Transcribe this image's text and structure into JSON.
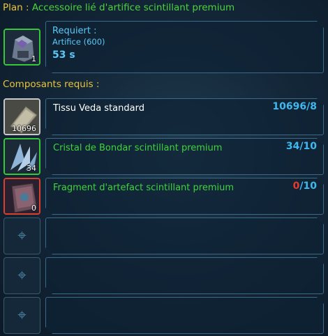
{
  "plan": {
    "label": "Plan :",
    "name": "Accessoire lié d'artifice scintillant premium"
  },
  "recipe": {
    "quantity": "1",
    "icon": "crafted-device-icon"
  },
  "requirements": {
    "label": "Requiert :",
    "skill": "Artifice (600)",
    "time": "53 s"
  },
  "components": {
    "label": "Composants requis :",
    "items": [
      {
        "name": "Tissu Veda standard",
        "have": "10696",
        "need": "/8",
        "qty": "10696",
        "rarity": "grey",
        "icon": "cloth-icon"
      },
      {
        "name": "Cristal de Bondar scintillant premium",
        "have": "34",
        "need": "/10",
        "qty": "34",
        "rarity": "green",
        "icon": "crystal-icon"
      },
      {
        "name": "Fragment d'artefact scintillant premium",
        "have": "0",
        "need": "/10",
        "qty": "0",
        "rarity": "red",
        "icon": "artifact-fragment-icon"
      }
    ],
    "empty_slot_icon": "empty-slot-icon"
  },
  "colors": {
    "title": "#e8c53a",
    "item_name_green": "#3fd43a",
    "count_blue": "#3fb8f0",
    "count_red": "#e63a2e",
    "panel_border": "#3c6a86"
  }
}
